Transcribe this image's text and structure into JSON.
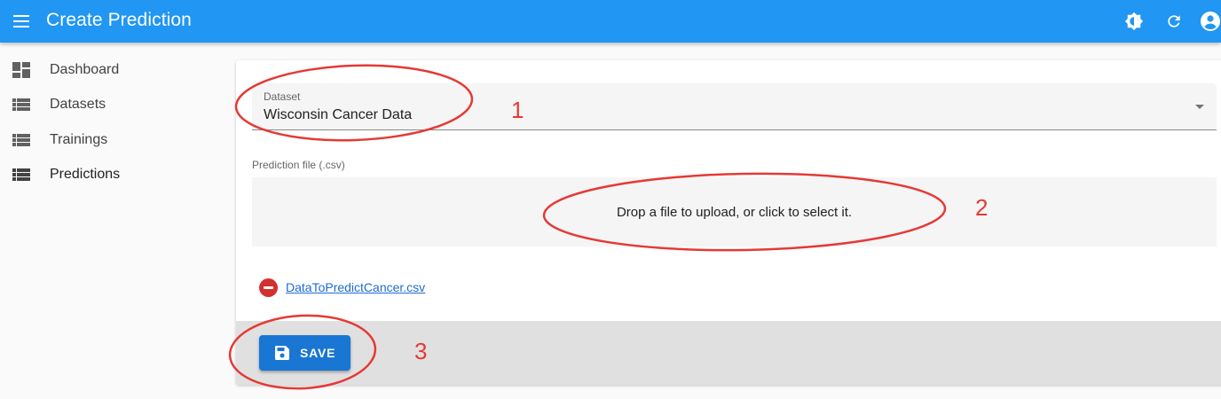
{
  "appbar": {
    "title": "Create Prediction",
    "color": "#2196f3",
    "icons": [
      "menu-icon",
      "brightness-icon",
      "refresh-icon",
      "account-icon"
    ]
  },
  "sidebar": {
    "items": [
      {
        "label": "Dashboard",
        "icon": "dashboard-icon"
      },
      {
        "label": "Datasets",
        "icon": "list-icon"
      },
      {
        "label": "Trainings",
        "icon": "list-icon"
      },
      {
        "label": "Predictions",
        "icon": "list-icon"
      }
    ]
  },
  "form": {
    "dataset": {
      "label": "Dataset",
      "value": "Wisconsin Cancer Data"
    },
    "prediction_file": {
      "label": "Prediction file (.csv)",
      "dropzone_text": "Drop a file to upload, or click to select it."
    },
    "selected_file": {
      "name": "DataToPredictCancer.csv",
      "remove_icon": "remove-circle-icon"
    }
  },
  "footer": {
    "save_label": "SAVE",
    "save_icon": "save-icon",
    "save_color": "#1976d2"
  },
  "annotations": {
    "color": "#e53935",
    "labels": [
      "1",
      "2",
      "3"
    ]
  }
}
